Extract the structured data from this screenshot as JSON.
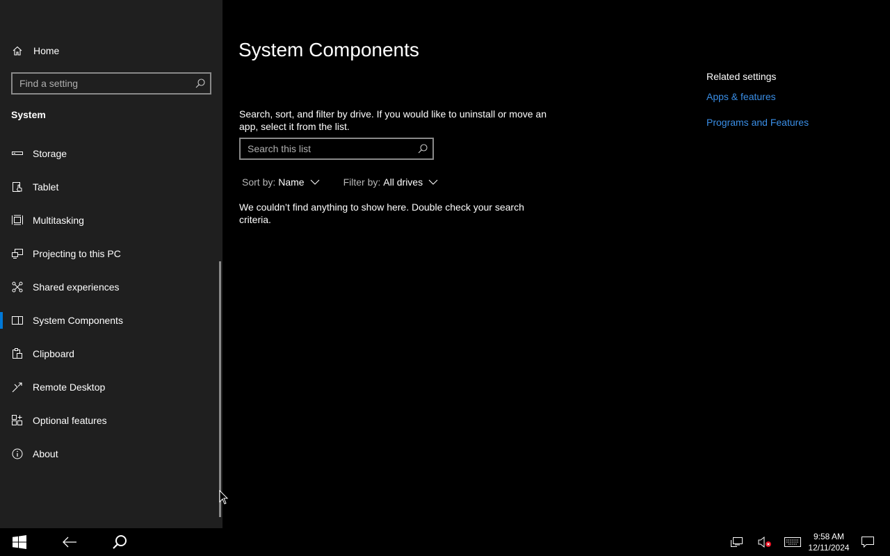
{
  "sidebar": {
    "home_label": "Home",
    "search_placeholder": "Find a setting",
    "section_title": "System",
    "items": [
      {
        "label": "Storage",
        "icon": "storage-icon"
      },
      {
        "label": "Tablet",
        "icon": "tablet-icon"
      },
      {
        "label": "Multitasking",
        "icon": "multitasking-icon"
      },
      {
        "label": "Projecting to this PC",
        "icon": "projecting-icon"
      },
      {
        "label": "Shared experiences",
        "icon": "shared-experiences-icon"
      },
      {
        "label": "System Components",
        "icon": "system-components-icon",
        "selected": true
      },
      {
        "label": "Clipboard",
        "icon": "clipboard-icon"
      },
      {
        "label": "Remote Desktop",
        "icon": "remote-desktop-icon"
      },
      {
        "label": "Optional features",
        "icon": "optional-features-icon"
      },
      {
        "label": "About",
        "icon": "about-icon"
      }
    ]
  },
  "main": {
    "title": "System Components",
    "description": "Search, sort, and filter by drive. If you would like to uninstall or move an app, select it from the list.",
    "search_placeholder": "Search this list",
    "sort_label": "Sort by:",
    "sort_value": "Name",
    "filter_label": "Filter by:",
    "filter_value": "All drives",
    "empty_message": "We couldn’t find anything to show here. Double check your search criteria."
  },
  "related": {
    "heading": "Related settings",
    "links": [
      "Apps & features",
      "Programs and Features"
    ]
  },
  "taskbar": {
    "time": "9:58 AM",
    "date": "12/11/2024"
  },
  "colors": {
    "accent": "#0078d7",
    "link": "#3a8ee6",
    "sidebar_bg": "#1f1f1f",
    "main_bg": "#000000"
  }
}
